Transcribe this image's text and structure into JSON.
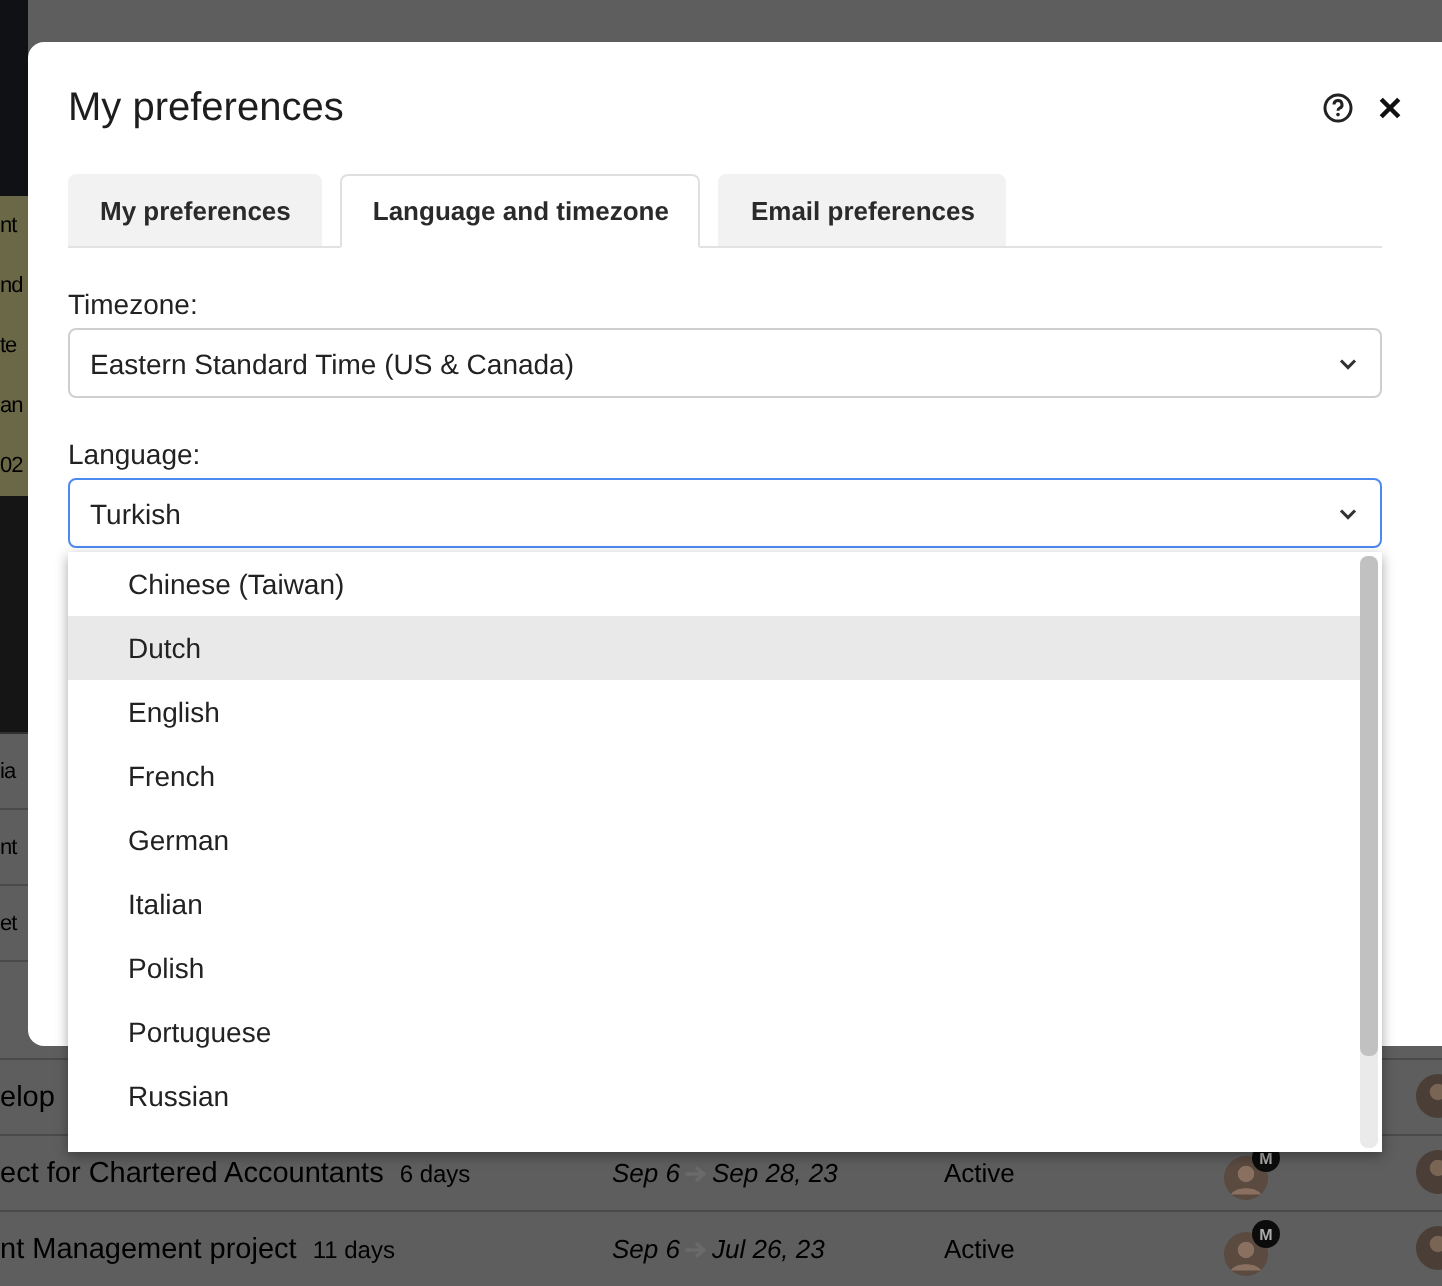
{
  "background": {
    "banner_fragments": [
      "nt",
      "nd",
      "te",
      "an",
      "02"
    ],
    "list_fragments": [
      "ia",
      "nt",
      "et"
    ],
    "rows": [
      {
        "name": "elop"
      },
      {
        "name": "ect for Chartered Accountants",
        "duration": "6 days",
        "start": "Sep 6",
        "end": "Sep 28, 23",
        "status": "Active",
        "badge": "M"
      },
      {
        "name": "nt Management project",
        "duration": "11 days",
        "start": "Sep 6",
        "end": "Jul 26, 23",
        "status": "Active",
        "badge": "M"
      }
    ]
  },
  "dialog": {
    "title": "My preferences",
    "tabs": [
      {
        "label": "My preferences",
        "selected": false
      },
      {
        "label": "Language and timezone",
        "selected": true
      },
      {
        "label": "Email preferences",
        "selected": false
      }
    ],
    "fields": [
      {
        "label": "Timezone:",
        "value": "Eastern Standard Time (US & Canada)",
        "focused": false
      },
      {
        "label": "Language:",
        "value": "Turkish",
        "focused": true
      }
    ]
  },
  "dropdown": {
    "options": [
      {
        "label": "Chinese (Taiwan)",
        "highlighted": false
      },
      {
        "label": "Dutch",
        "highlighted": true
      },
      {
        "label": "English",
        "highlighted": false
      },
      {
        "label": "French",
        "highlighted": false
      },
      {
        "label": "German",
        "highlighted": false
      },
      {
        "label": "Italian",
        "highlighted": false
      },
      {
        "label": "Polish",
        "highlighted": false
      },
      {
        "label": "Portuguese",
        "highlighted": false
      },
      {
        "label": "Russian",
        "highlighted": false
      }
    ]
  }
}
